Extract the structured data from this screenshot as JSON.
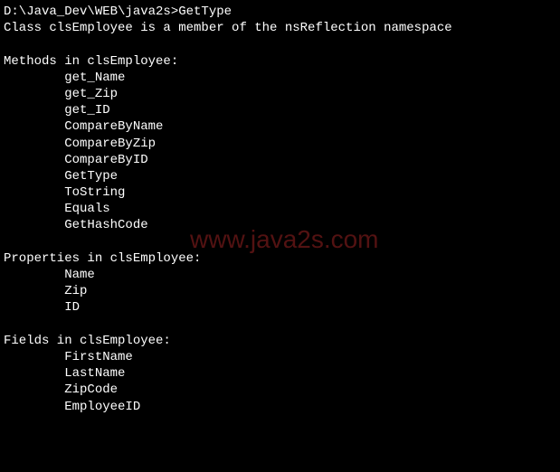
{
  "prompt": "D:\\Java_Dev\\WEB\\java2s>GetType",
  "classInfo": "Class clsEmployee is a member of the nsReflection namespace",
  "methodsHeader": "Methods in clsEmployee:",
  "methods": [
    "get_Name",
    "get_Zip",
    "get_ID",
    "CompareByName",
    "CompareByZip",
    "CompareByID",
    "GetType",
    "ToString",
    "Equals",
    "GetHashCode"
  ],
  "propertiesHeader": "Properties in clsEmployee:",
  "properties": [
    "Name",
    "Zip",
    "ID"
  ],
  "fieldsHeader": "Fields in clsEmployee:",
  "fields": [
    "FirstName",
    "LastName",
    "ZipCode",
    "EmployeeID"
  ],
  "watermark": "www.java2s.com"
}
